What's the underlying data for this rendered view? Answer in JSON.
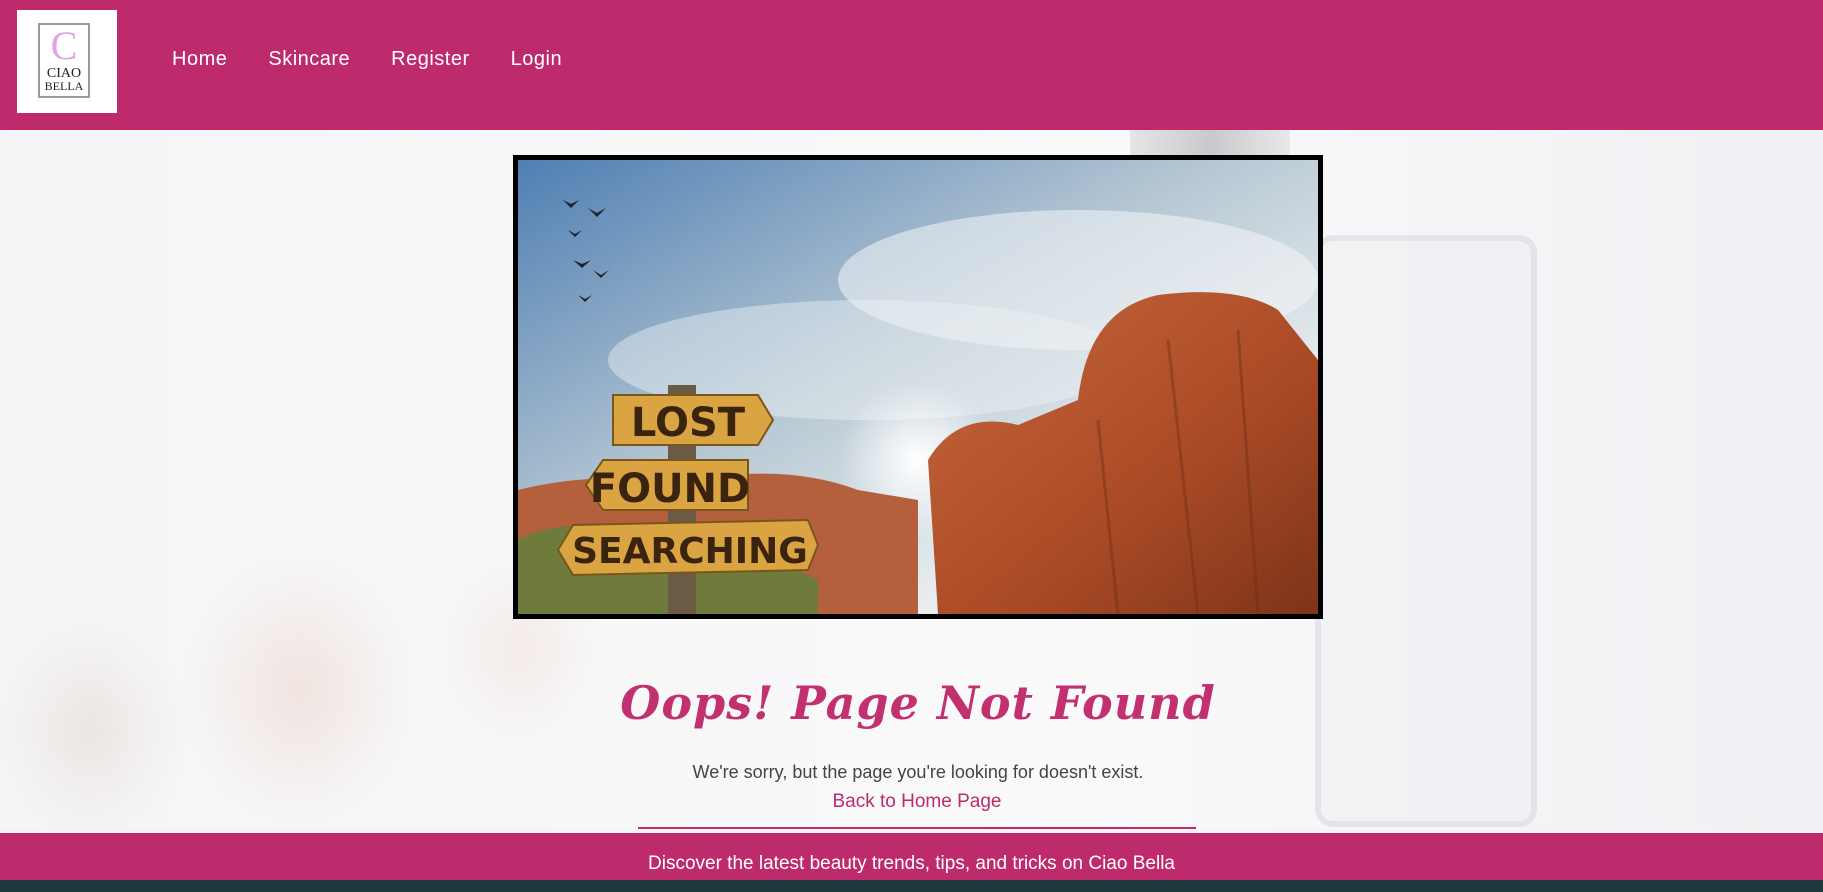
{
  "brand": {
    "logo_letter": "C",
    "logo_line1": "CIAO",
    "logo_line2": "BELLA"
  },
  "nav": {
    "items": [
      {
        "label": "Home"
      },
      {
        "label": "Skincare"
      },
      {
        "label": "Register"
      },
      {
        "label": "Login"
      }
    ]
  },
  "hero": {
    "sign_lines": [
      "LOST",
      "FOUND",
      "SEARCHING"
    ]
  },
  "main": {
    "title": "Oops! Page Not Found",
    "message": "We're sorry, but the page you're looking for doesn't exist.",
    "back_link": "Back to Home Page"
  },
  "footer": {
    "text": "Discover the latest beauty trends, tips, and tricks on Ciao Bella"
  },
  "colors": {
    "brand": "#bd2b6c",
    "title": "#c3306f",
    "logo_accent": "#e4a0e4"
  }
}
